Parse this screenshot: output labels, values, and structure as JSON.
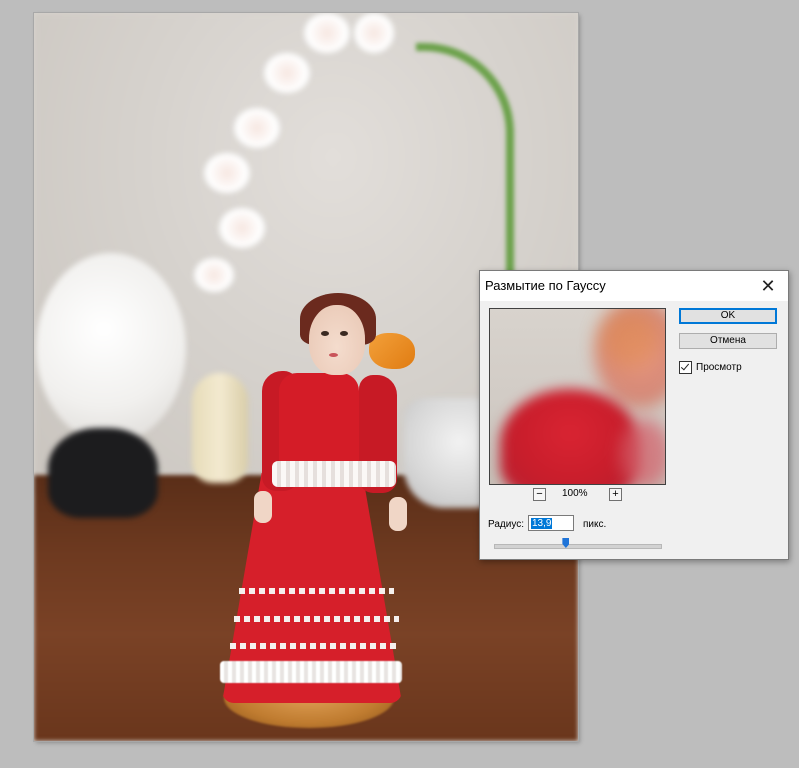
{
  "dialog": {
    "title": "Размытие по Гауссу",
    "close_icon": "close-icon",
    "ok_label": "OK",
    "cancel_label": "Отмена",
    "preview_label": "Просмотр",
    "preview_checked": true,
    "zoom_minus": "−",
    "zoom_plus": "+",
    "zoom_value": "100%",
    "radius_label": "Радиус:",
    "radius_value": "13,9",
    "radius_unit": "пикс.",
    "slider_level": 0.43
  },
  "colors": {
    "accent": "#0078d7",
    "dress_red": "#d61f2a",
    "bow_orange": "#e07c12",
    "table_brown": "#6e3a20"
  }
}
